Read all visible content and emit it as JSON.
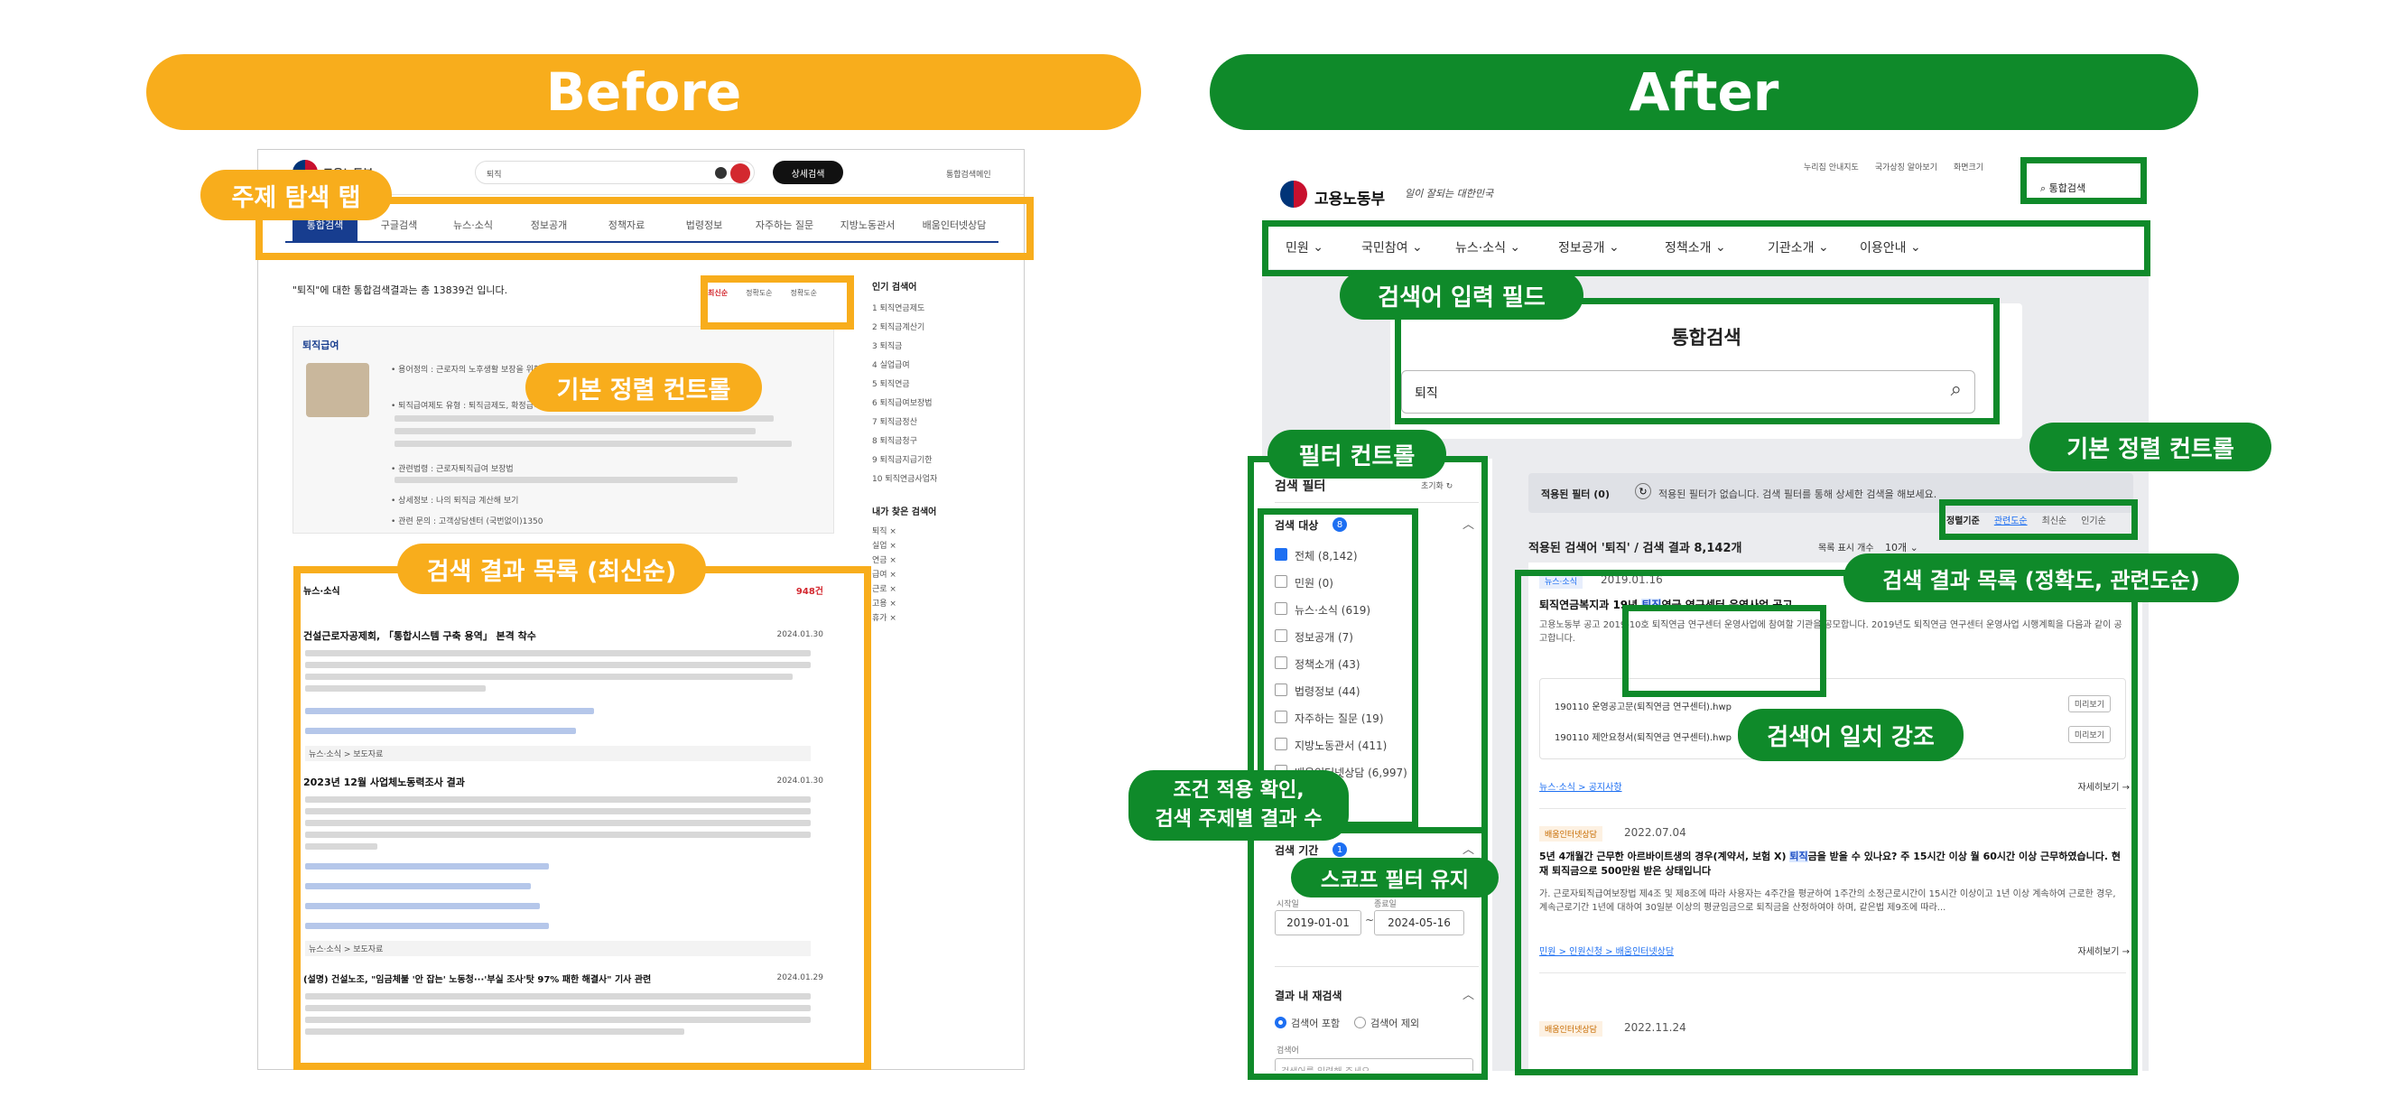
{
  "titles": {
    "before": "Before",
    "after": "After"
  },
  "before": {
    "brand": "고용노동부",
    "search_value": "퇴직",
    "search_button": "상세검색",
    "top_link": "통합검색메인",
    "tabs": [
      "통합검색",
      "구글검색",
      "뉴스·소식",
      "정보공개",
      "정책자료",
      "법령정보",
      "자주하는 질문",
      "지방노동관서",
      "배움인터넷상담"
    ],
    "result_summary": "\"퇴직\"에 대한 통합검색결과는 총 13839건 입니다.",
    "sort_options": [
      "최신순",
      "정확도순",
      "정확도순"
    ],
    "popular_title": "인기 검색어",
    "popular_items": [
      "1 퇴직연금제도",
      "2 퇴직금계산기",
      "3 퇴직금",
      "4 실업급여",
      "5 퇴직연금",
      "6 퇴직급여보장법",
      "7 퇴직금정산",
      "8 퇴직금청구",
      "9 퇴직금지급기한",
      "10 퇴직연금사업자"
    ],
    "recent_title": "내가 찾은 검색어",
    "recent_items": [
      "퇴직 ×",
      "실업 ×",
      "연금 ×",
      "급여 ×",
      "근로 ×",
      "고용 ×",
      "휴가 ×"
    ],
    "feature_title": "퇴직급여",
    "feature_lines": [
      "• 용어정의 : 근로자의 노후생활 보장을 위한 제도",
      "• 퇴직급여제도 유형 : 퇴직금제도, 확정급여형, 확정기여형",
      "• 관련법령 : 근로자퇴직급여 보장법",
      "• 상세정보 : 나의 퇴직금 계산해 보기",
      "• 관련 문의 : 고객상담센터 (국번없이)1350"
    ],
    "list_section": "뉴스·소식",
    "list_count": "948건",
    "articles": [
      {
        "title": "건설근로자공제회, 「통합시스템 구축 용역」 본격 착수",
        "date": "2024.01.30",
        "footer": "뉴스·소식 > 보도자료"
      },
      {
        "title": "2023년 12월 사업체노동력조사 결과",
        "date": "2024.01.30",
        "footer": "뉴스·소식 > 보도자료"
      },
      {
        "title": "(설명) 건설노조, \"임금체불 '안 잡는' 노동청···'부실 조사'탓 97% 패한 해결사\" 기사 관련",
        "date": "2024.01.29",
        "footer": ""
      }
    ]
  },
  "before_annotations": {
    "tab_label": "주제 탐색 탭",
    "sort_label": "기본 정렬 컨트롤",
    "list_label": "검색 결과 목록 (최신순)"
  },
  "after": {
    "brand": "고용노동부",
    "slogan": "일이 잘되는 대한민국",
    "top_links": [
      "누리집 안내지도",
      "국가상징 알아보기",
      "화면크기"
    ],
    "header_search": "통합검색",
    "nav": [
      "민원",
      "국민참여",
      "뉴스·소식",
      "정보공개",
      "정책소개",
      "기관소개",
      "이용안내"
    ],
    "panel_title": "통합검색",
    "search_value": "퇴직",
    "filter_title": "검색 필터",
    "filter_reset": "초기화",
    "scope_title": "검색 대상",
    "scope_badge": "8",
    "scope_items": [
      "전체 (8,142)",
      "민원 (0)",
      "뉴스·소식 (619)",
      "정보공개 (7)",
      "정책소개 (43)",
      "법령정보 (44)",
      "자주하는 질문 (19)",
      "지방노동관서 (411)",
      "배움인터넷상담 (6,997)"
    ],
    "date_title": "검색 기간",
    "date_badge": "1",
    "date_start_label": "시작일",
    "date_end_label": "종료일",
    "date_start": "2019-01-01",
    "date_end": "2024-05-16",
    "within_title": "결과 내 재검색",
    "within_options": [
      "검색어 포함",
      "검색어 제외"
    ],
    "within_label": "검색어",
    "within_placeholder": "검색어를 입력해 주세요",
    "applied_label": "적용된 필터 (0)",
    "applied_text": "적용된 필터가 없습니다. 검색 필터를 통해 상세한 검색을 해보세요.",
    "result_heading": "적용된 검색어 '퇴직' / 검색 결과 8,142개",
    "per_page_label": "목록 표시 개수",
    "per_page_value": "10개",
    "sort_label": "정렬기준",
    "sort_options": [
      "관련도순",
      "최신순",
      "인기순"
    ],
    "results": [
      {
        "tag": "뉴스·소식",
        "date": "2019.01.16",
        "title_pre": "퇴직연금복지과 19년 ",
        "title_hl": "퇴직",
        "title_post": "연금 연구센터 운영사업 공고",
        "body": "고용노동부 공고 2019-10호 퇴직연금 연구센터 운영사업에 참여할 기관을 공모합니다. 2019년도 퇴직연금 연구센터 운영사업 시행계획을 다음과 같이 공고합니다.",
        "files": [
          "190110 운영공고문(퇴직연금 연구센터).hwp",
          "190110 제안요청서(퇴직연금 연구센터).hwp"
        ],
        "file_btn": "미리보기",
        "path": "뉴스·소식 > 공지사항",
        "more": "자세히보기 →"
      },
      {
        "tag": "배움인터넷상담",
        "date": "2022.07.04",
        "title_pre": "5년 4개월간 근무한 아르바이트생의 경우(계약서, 보험 X) ",
        "title_hl": "퇴직",
        "title_post": "금을 받을 수 있나요? 주 15시간 이상 월 60시간 이상 근무하였습니다. 현재 퇴직금으로 500만원 받은 상태입니다",
        "body": "가. 근로자퇴직급여보장법 제4조 및 제8조에 따라 사용자는 4주간을 평균하여 1주간의 소정근로시간이 15시간 이상이고 1년 이상 계속하여 근로한 경우, 계속근로기간 1년에 대하여 30일분 이상의 평균임금으로 퇴직금을 산정하여야 하며, 같은법 제9조에 따라...",
        "path": "민원 > 인원신청 > 배움인터넷상담",
        "more": "자세히보기 →"
      },
      {
        "tag": "배움인터넷상담",
        "date": "2022.11.24"
      }
    ]
  },
  "after_annotations": {
    "input_field": "검색어 입력 필드",
    "filter_control": "필터 컨트롤",
    "condition_check": "조건 적용 확인,\n검색 주제별 결과 수",
    "scope_keep": "스코프 필터 유지",
    "sort_control": "기본 정렬 컨트롤",
    "result_list": "검색 결과 목록 (정확도, 관련도순)",
    "highlight": "검색어 일치 강조"
  }
}
